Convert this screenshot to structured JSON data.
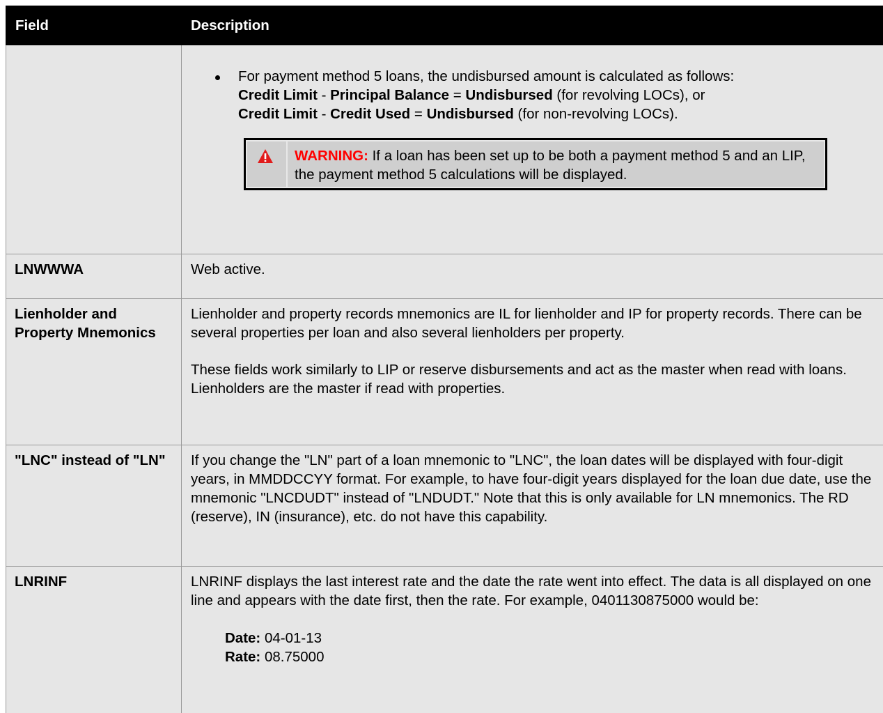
{
  "table": {
    "headers": {
      "field": "Field",
      "description": "Description"
    },
    "rows": {
      "pm5": {
        "field": "",
        "bullet": {
          "intro": "For payment method 5 loans, the undisbursed amount is calculated as follows:",
          "line1": {
            "a": "Credit Limit",
            "op1": " - ",
            "b": "Principal Balance",
            "op2": " = ",
            "c": "Undisbursed",
            "note": " (for revolving LOCs), or"
          },
          "line2": {
            "a": "Credit Limit",
            "op1": " - ",
            "b": "Credit Used",
            "op2": " = ",
            "c": "Undisbursed",
            "note": " (for non-revolving LOCs)."
          }
        },
        "warning": {
          "icon": "warning-triangle-icon",
          "label": "WARNING:",
          "text": " If a loan has been set up to be both a payment method 5 and an LIP, the payment method 5 calculations will be displayed."
        }
      },
      "lnwwwa": {
        "field": "LNWWWA",
        "desc": "Web active."
      },
      "lienholder": {
        "field": "Lienholder and Property Mnemonics",
        "p1": "Lienholder and property records mnemonics are IL for lienholder and IP for property records. There can be several properties per loan and also several lienholders per property.",
        "p2": "These fields work similarly to LIP or reserve disbursements and act as the master when read with loans. Lienholders are the master if read with properties."
      },
      "lnc": {
        "field": "\"LNC\" instead of \"LN\"",
        "desc": "If you change the \"LN\" part of a loan mnemonic to \"LNC\", the loan dates will be displayed with four-digit years, in MMDDCCYY format. For example, to have four-digit years displayed for the loan due date, use the mnemonic \"LNCDUDT\" instead of \"LNDUDT.\" Note that this is only available for LN mnemonics. The RD (reserve), IN (insurance), etc. do not have this capability."
      },
      "lnrinf": {
        "field": "LNRINF",
        "desc": "LNRINF displays the last interest rate and the date the rate went into effect. The data is all displayed on one line and appears with the date first, then the rate. For example, 0401130875000 would be:",
        "date_label": "Date:",
        "date_value": " 04-01-13",
        "rate_label": "Rate:",
        "rate_value": " 08.75000"
      }
    }
  },
  "colors": {
    "header_bg": "#000000",
    "cell_bg": "#e6e6e6",
    "warning_label": "#ff0000",
    "warning_bg": "#cfcfcf",
    "warning_icon": "#e11b1b"
  }
}
